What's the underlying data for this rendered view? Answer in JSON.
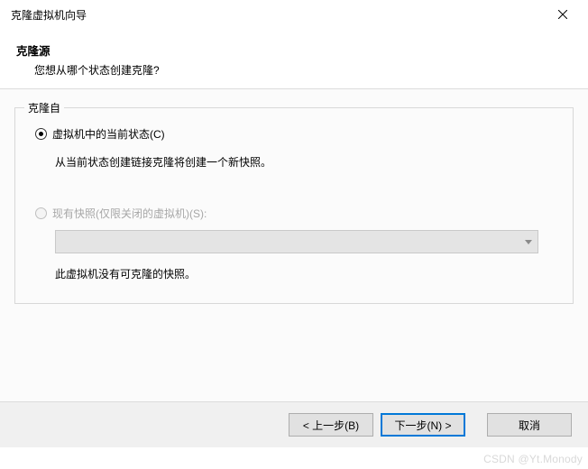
{
  "window": {
    "title": "克隆虚拟机向导"
  },
  "header": {
    "title": "克隆源",
    "subtitle": "您想从哪个状态创建克隆?"
  },
  "group": {
    "legend": "克隆自",
    "option1": {
      "label": "虚拟机中的当前状态(C)",
      "desc": "从当前状态创建链接克隆将创建一个新快照。"
    },
    "option2": {
      "label": "现有快照(仅限关闭的虚拟机)(S):",
      "combo_msg": "此虚拟机没有可克隆的快照。"
    }
  },
  "buttons": {
    "back": "< 上一步(B)",
    "next": "下一步(N) >",
    "cancel": "取消"
  },
  "watermark": "CSDN @Yt.Monody"
}
